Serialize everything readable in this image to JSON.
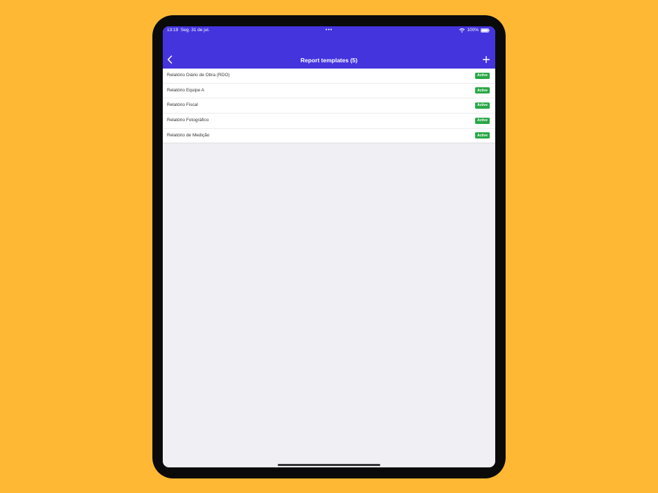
{
  "status_bar": {
    "time": "13:19",
    "date": "Seg. 31 de jul.",
    "dots": "•••",
    "battery": "100%"
  },
  "header": {
    "title": "Report templates (5)",
    "back_icon": "chevron-left-icon",
    "add_icon": "plus-icon"
  },
  "templates": [
    {
      "name": "Relatório Diário de Obra (RDO)",
      "status": "Active"
    },
    {
      "name": "Relatório Equipe A",
      "status": "Active"
    },
    {
      "name": "Relatório Fiscal",
      "status": "Active"
    },
    {
      "name": "Relatório Fotográfico",
      "status": "Active"
    },
    {
      "name": "Relatório de Medição",
      "status": "Active"
    }
  ],
  "colors": {
    "background": "#FFB833",
    "accent": "#4434DE",
    "active_badge": "#28A745"
  }
}
